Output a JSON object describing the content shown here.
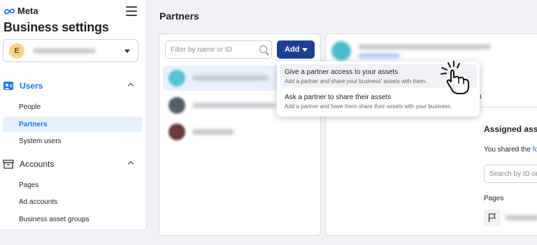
{
  "brand": {
    "name": "Meta"
  },
  "app": {
    "title": "Business settings"
  },
  "account": {
    "avatar_letter": "E"
  },
  "sidebar": {
    "users": {
      "label": "Users",
      "items": [
        {
          "label": "People"
        },
        {
          "label": "Partners"
        },
        {
          "label": "System users"
        }
      ]
    },
    "accounts": {
      "label": "Accounts",
      "items": [
        {
          "label": "Pages"
        },
        {
          "label": "Ad accounts"
        },
        {
          "label": "Business asset groups"
        }
      ]
    }
  },
  "main": {
    "title": "Partners",
    "filter_placeholder": "Filter by name or ID",
    "add_label": "Add"
  },
  "menu": {
    "items": [
      {
        "title": "Give a partner access to your assets",
        "desc": "Add a partner and share your business' assets with them."
      },
      {
        "title": "Ask a partner to share their assets",
        "desc": "Add a partner and have them share their assets with your business."
      }
    ]
  },
  "detail": {
    "header_fragment": "u",
    "assigned_title": "Assigned ass",
    "shared_prefix": "You shared the ",
    "shared_link": "fo",
    "search_placeholder": "Search by ID or",
    "pages_label": "Pages"
  },
  "colors": {
    "accent": "#1877f2",
    "add_button": "#1c3f94",
    "selected_bg": "#e7f0fd"
  },
  "icons": {
    "hamburger": "hamburger-icon",
    "users": "users-icon",
    "accounts": "briefcase-icon",
    "search": "search-icon",
    "flag": "flag-icon",
    "pointer": "pointer-hand-icon"
  }
}
